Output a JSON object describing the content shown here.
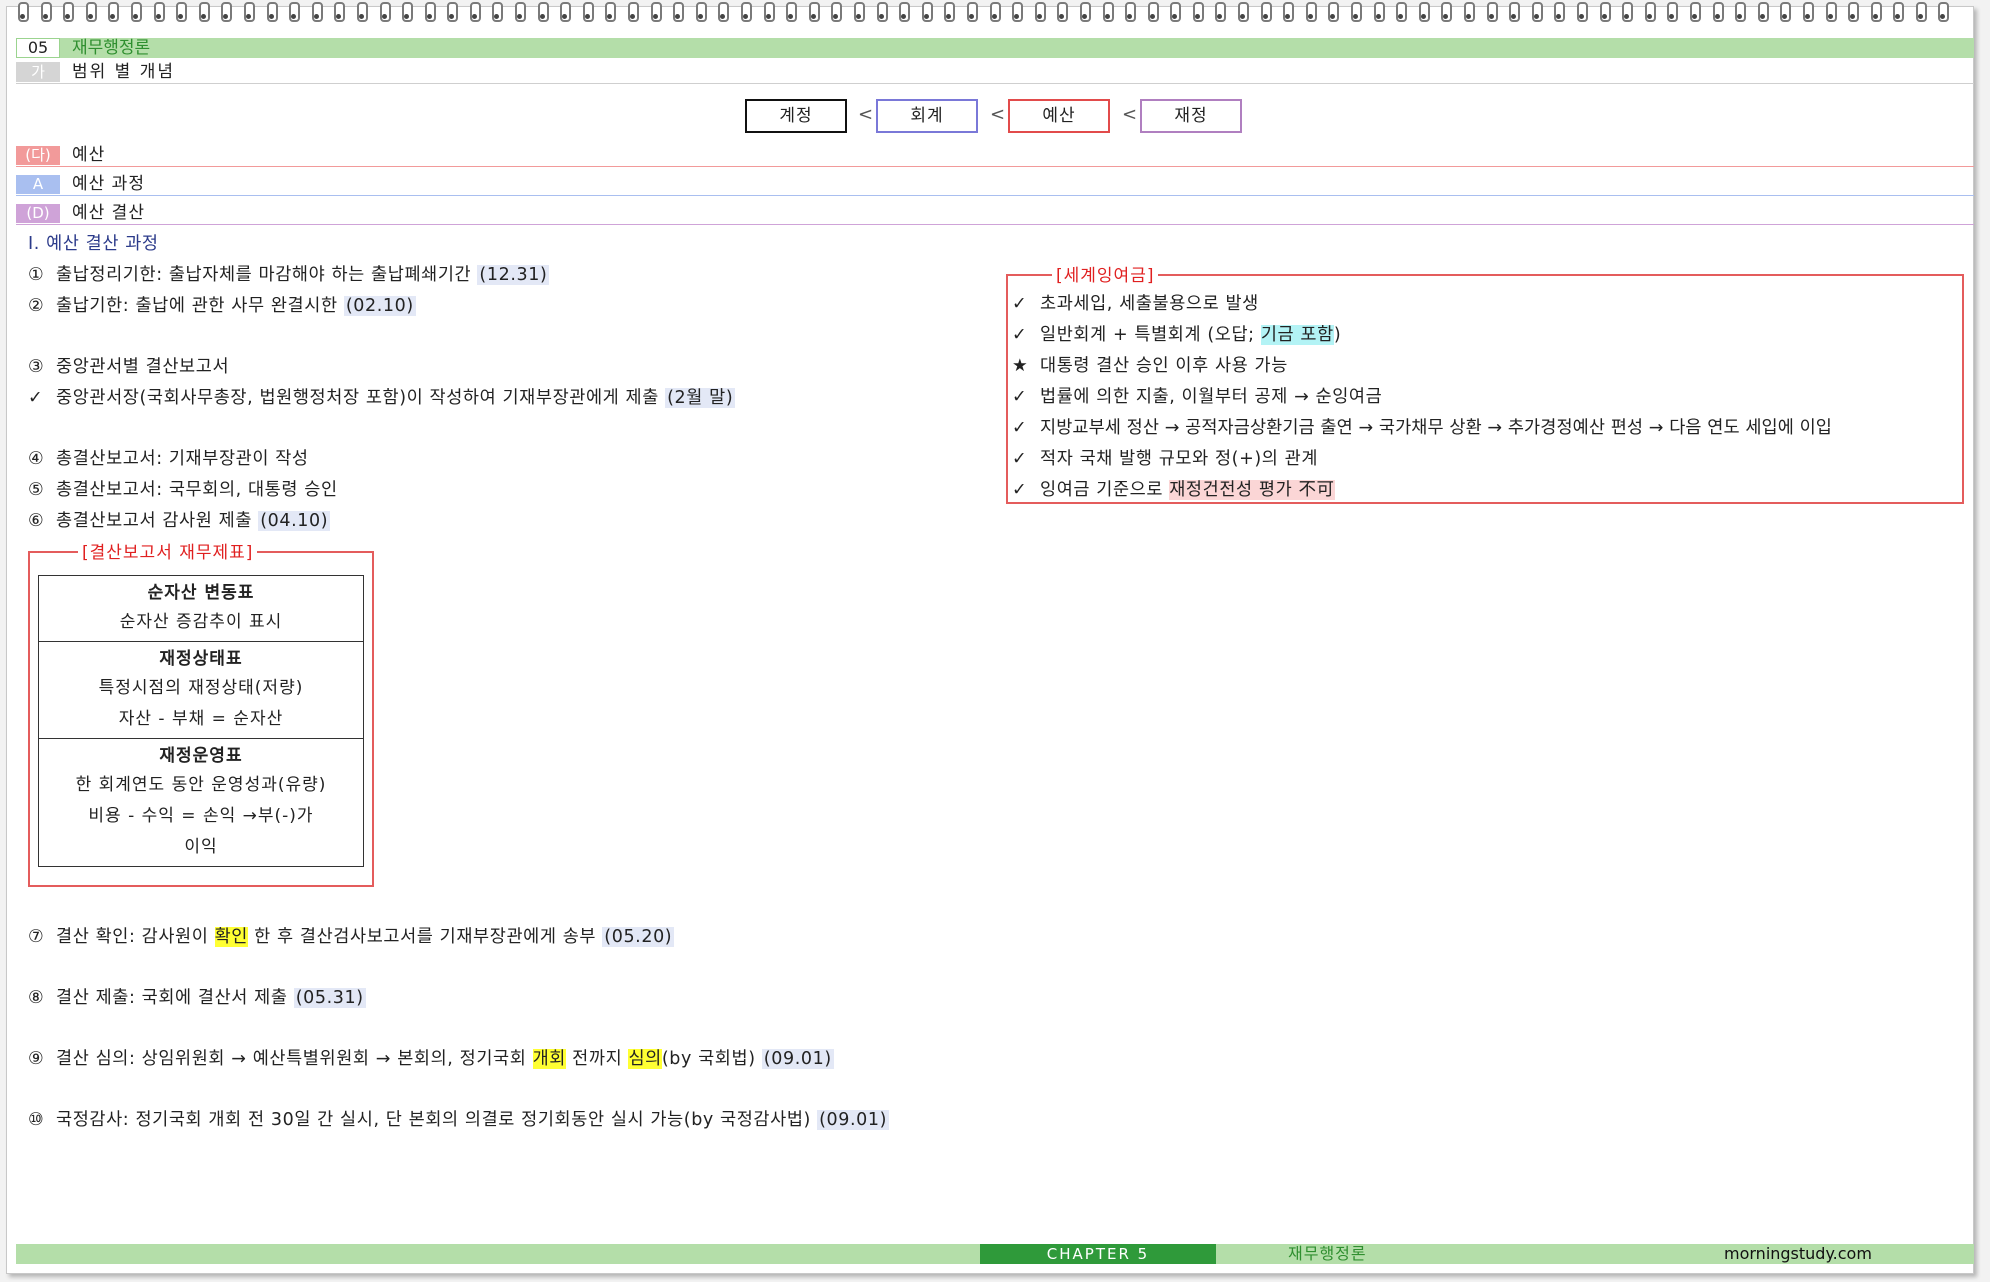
{
  "header": {
    "chapter_num": "05",
    "chapter_title": "재무행정론"
  },
  "subheader": {
    "tag": "가",
    "label": "범위 별 개념"
  },
  "concepts": {
    "items": [
      "계정",
      "회계",
      "예산",
      "재정"
    ],
    "separator": "<",
    "colors": [
      "#111111",
      "#7a78d8",
      "#e24b4b",
      "#b07fc0"
    ]
  },
  "sections": [
    {
      "tag": "(다)",
      "label": "예산",
      "color": "#f29a9a"
    },
    {
      "tag": "A",
      "label": "예산 과정",
      "color": "#a9bff0"
    },
    {
      "tag": "(D)",
      "label": "예산 결산",
      "color": "#cfa3d8"
    }
  ],
  "process": {
    "heading": "Ⅰ. 예산 결산 과정",
    "lines": [
      {
        "sym": "①",
        "text": "출납정리기한: 출납자체를 마감해야 하는 출납폐쇄기간",
        "date": "(12.31)"
      },
      {
        "sym": "②",
        "text": "출납기한: 출납에 관한 사무 완결시한",
        "date": "(02.10)"
      },
      {
        "sym": "③",
        "text": "중앙관서별 결산보고서"
      },
      {
        "sym": "✓",
        "text": "중앙관서장(국회사무총장, 법원행정처장 포함)이 작성하여 기재부장관에게 제출",
        "date": "(2월 말)"
      },
      {
        "sym": "④",
        "text": "총결산보고서: 기재부장관이 작성"
      },
      {
        "sym": "⑤",
        "text": "총결산보고서: 국무회의, 대통령 승인"
      },
      {
        "sym": "⑥",
        "text": "총결산보고서 감사원 제출 ",
        "date": "(04.10)"
      }
    ],
    "line7": {
      "sym": "⑦",
      "a": "결산 확인: 감사원이 ",
      "hl": "확인",
      "b": " 한 후 결산검사보고서를 기재부장관에게 송부 ",
      "date": "(05.20)"
    },
    "line8": {
      "sym": "⑧",
      "text": "결산 제출: 국회에 결산서 제출 ",
      "date": "(05.31)"
    },
    "line9": {
      "sym": "⑨",
      "a": "결산 심의: 상임위원회 → 예산특별위원회 → 본회의, 정기국회 ",
      "hl1": "개회",
      "b": " 전까지 ",
      "hl2": "심의",
      "c": "(by 국회법) ",
      "date": "(09.01)"
    },
    "line10": {
      "sym": "⑩",
      "text": "국정감사: 정기국회 개회 전 30일 간 실시, 단 본회의 의결로 정기회동안 실시 가능(by 국정감사법) ",
      "date": "(09.01)"
    }
  },
  "financial_statements": {
    "title": "[결산보고서 재무제표]",
    "cells": [
      {
        "head": "순자산 변동표",
        "lines": [
          "순자산 증감추이 표시"
        ]
      },
      {
        "head": "재정상태표",
        "lines": [
          "특정시점의 재정상태(저량)",
          "자산 - 부채 = 순자산"
        ]
      },
      {
        "head": "재정운영표",
        "lines": [
          "한 회계연도 동안 운영성과(유량)",
          "비용 - 수익 = 손익 →부(-)가",
          "이익"
        ]
      }
    ]
  },
  "surplus": {
    "title": "[세계잉여금]",
    "lines": [
      {
        "sym": "✓",
        "text": "초과세입, 세출불용으로 발생"
      },
      {
        "sym": "✓",
        "a": "일반회계 + 특별회계 (오답; ",
        "hl": "기금 포함",
        "b": ")"
      },
      {
        "sym": "★",
        "text": "대통령 결산 승인 이후 사용 가능"
      },
      {
        "sym": "✓",
        "text": "법률에 의한 지출, 이월부터 공제 → 순잉여금"
      },
      {
        "sym": "✓",
        "text": "지방교부세 정산 → 공적자금상환기금 출연 → 국가채무 상환 → 추가경정예산 편성 → 다음 연도 세입에 이입"
      },
      {
        "sym": "✓",
        "text": "적자 국채 발행 규모와 정(+)의 관계"
      },
      {
        "sym": "✓",
        "a": "잉여금 기준으로 ",
        "hl": "재정건전성 평가 不可"
      }
    ]
  },
  "footer": {
    "chapter": "CHAPTER 5",
    "title": "재무행정론",
    "site": "morningstudy.com"
  }
}
